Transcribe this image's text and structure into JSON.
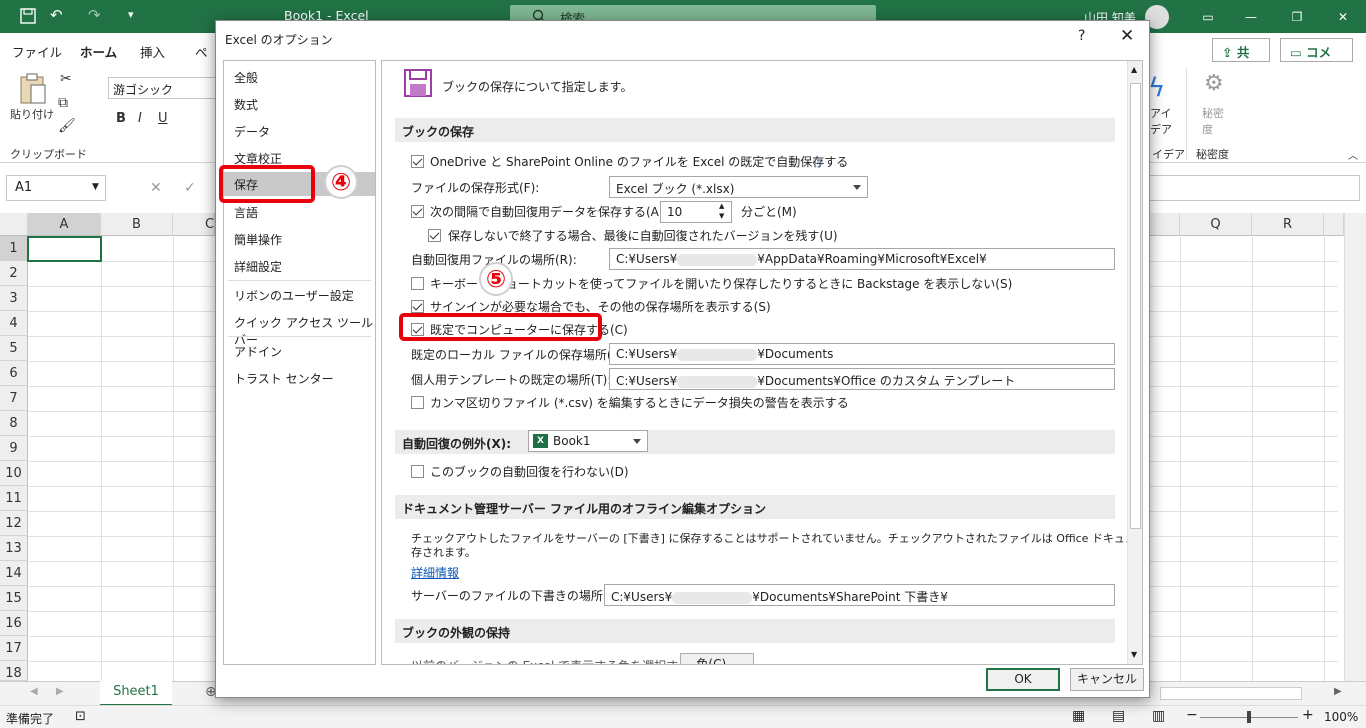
{
  "titlebar": {
    "title": "Book1  -  Excel",
    "search": "検索",
    "user": "山田 知美"
  },
  "tabs": [
    "ファイル",
    "ホーム",
    "挿入",
    "ペ"
  ],
  "share": {
    "share_label": "共有",
    "comment_label": "コメント"
  },
  "ribbon": {
    "paste": "貼り付け",
    "clipboard": "クリップボード",
    "font": "游ゴシック",
    "bold": "B",
    "italic": "I",
    "underline": "U",
    "idea1": "アイ",
    "idea2": "デア",
    "idea_group": "イデア",
    "sens1": "秘密",
    "sens2": "度",
    "sens_group": "秘密度"
  },
  "formula": {
    "namebox": "A1"
  },
  "grid": {
    "cols": [
      "A",
      "B",
      "C",
      "Q",
      "R"
    ],
    "rows": [
      "1",
      "2",
      "3",
      "4",
      "5",
      "6",
      "7",
      "8",
      "9",
      "10",
      "11",
      "12",
      "13",
      "14",
      "15",
      "16",
      "17",
      "18"
    ]
  },
  "sheet": {
    "name": "Sheet1"
  },
  "status": {
    "ready": "準備完了",
    "zoom": "100%"
  },
  "dialog": {
    "title": "Excel のオプション",
    "help": "?",
    "close": "✕",
    "nav": [
      "全般",
      "数式",
      "データ",
      "文章校正",
      "保存",
      "言語",
      "簡単操作",
      "詳細設定",
      "リボンのユーザー設定",
      "クイック アクセス ツール バー",
      "アドイン",
      "トラスト センター"
    ],
    "header": "ブックの保存について指定します。",
    "sec_save": "ブックの保存",
    "onedrive": "OneDrive と SharePoint Online のファイルを Excel の既定で自動保存する",
    "format_label": "ファイルの保存形式(F):",
    "format_value": "Excel ブック (*.xlsx)",
    "autorecover": "次の間隔で自動回復用データを保存する(A):",
    "interval": "10",
    "minutes": "分ごと(M)",
    "keep_last": "保存しないで終了する場合、最後に自動回復されたバージョンを残す(U)",
    "ar_location_label": "自動回復用ファイルの場所(R):",
    "ar_path_a": "C:¥Users¥",
    "ar_path_b": "¥AppData¥Roaming¥Microsoft¥Excel¥",
    "backstage": "キーボード ショートカットを使ってファイルを開いたり保存したりするときに Backstage を表示しない(S)",
    "signin": "サインインが必要な場合でも、その他の保存場所を表示する(S)",
    "computer": "既定でコンピューターに保存する(C)",
    "local_label": "既定のローカル ファイルの保存場所(I):",
    "local_a": "C:¥Users¥",
    "local_b": "¥Documents",
    "tpl_label": "個人用テンプレートの既定の場所(T):",
    "tpl_a": "C:¥Users¥",
    "tpl_b": "¥Documents¥Office のカスタム テンプレート",
    "csv": "カンマ区切りファイル (*.csv) を編集するときにデータ損失の警告を表示する",
    "sec_except": "自動回復の例外(X):",
    "book": "Book1",
    "disable_ar": "このブックの自動回復を行わない(D)",
    "sec_offline": "ドキュメント管理サーバー ファイル用のオフライン編集オプション",
    "offline_text1": "チェックアウトしたファイルをサーバーの [下書き] に保存することはサポートされていません。チェックアウトされたファイルは Office ドキュメント キャッシュに保",
    "offline_text2": "存されます。",
    "more_info": "詳細情報",
    "drafts_label": "サーバーのファイルの下書きの場所(V):",
    "drafts_a": "C:¥Users¥",
    "drafts_b": "¥Documents¥SharePoint 下書き¥",
    "sec_appearance": "ブックの外観の保持",
    "appearance_row": "以前のバージョンの Excel で表示する色を選択する:",
    "color_btn": "色(C)...",
    "ok": "OK",
    "cancel": "キャンセル"
  },
  "annotations": {
    "step4": "④",
    "step5": "⑤"
  },
  "colors": {
    "excel_green": "#217346",
    "callout_red": "#e8000b"
  }
}
